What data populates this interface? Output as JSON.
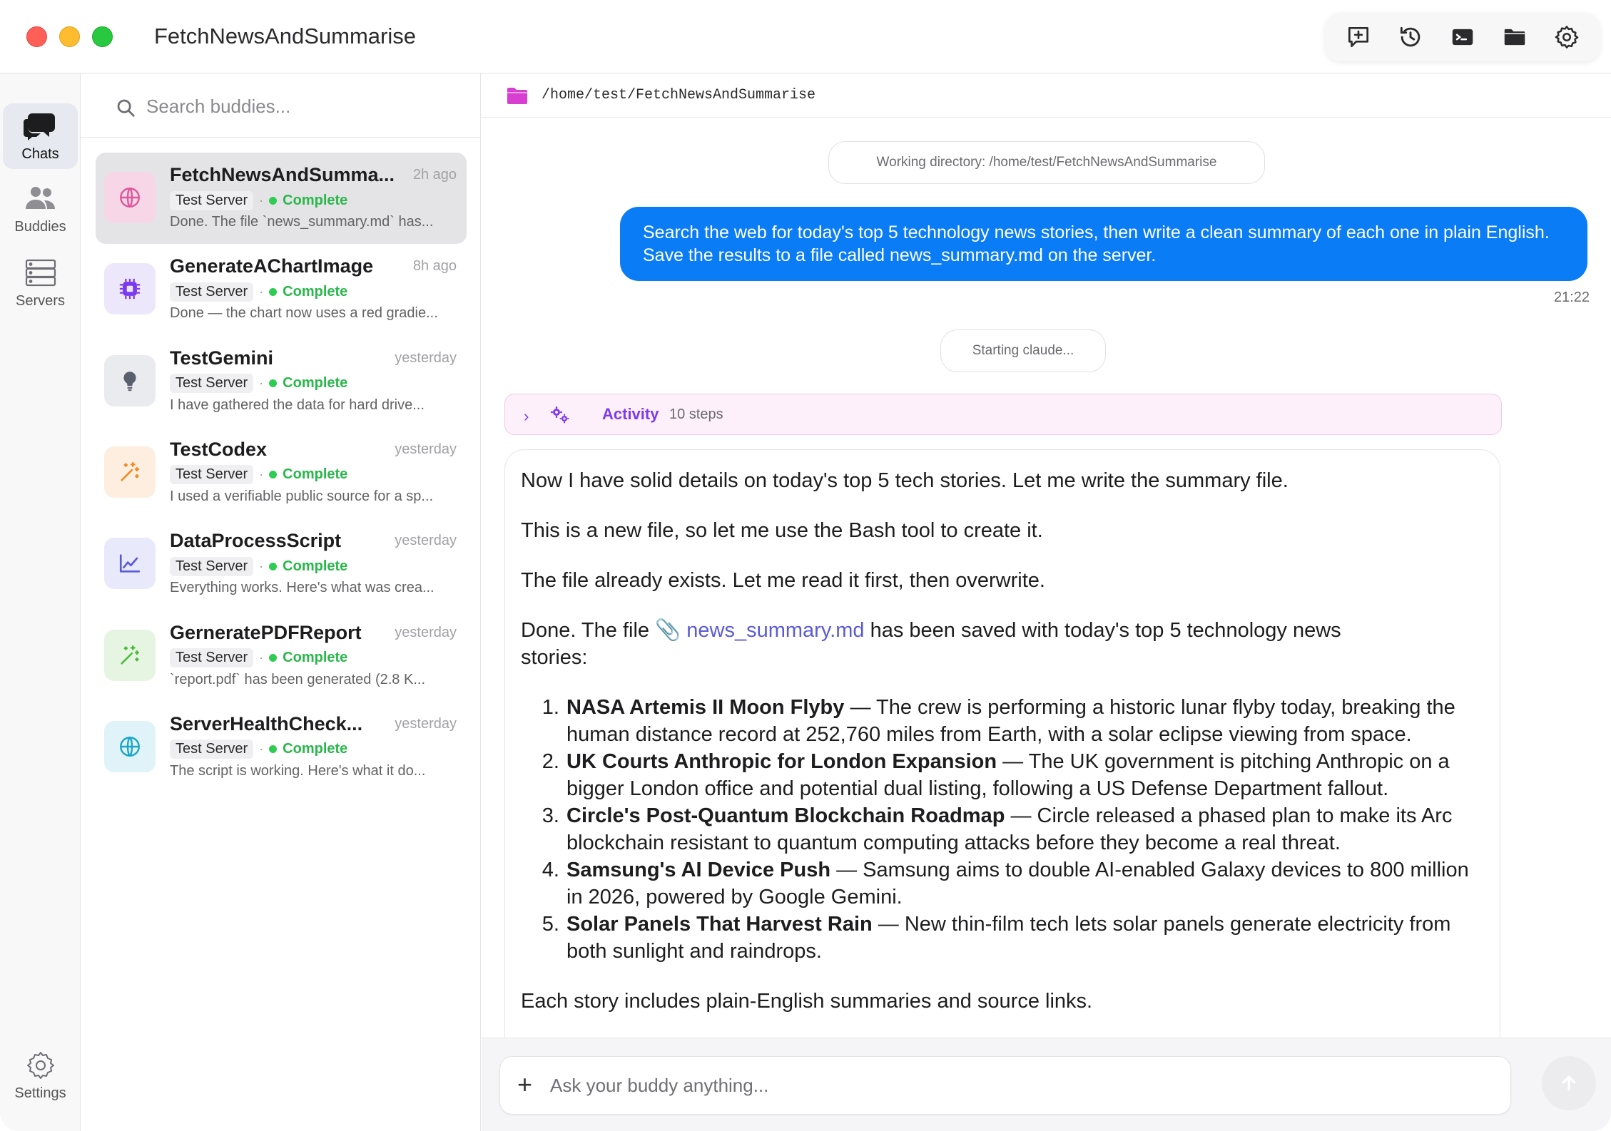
{
  "window": {
    "title": "FetchNewsAndSummarise"
  },
  "rail": {
    "items": [
      {
        "label": "Chats",
        "icon": "chat-bubbles-icon"
      },
      {
        "label": "Buddies",
        "icon": "people-icon"
      },
      {
        "label": "Servers",
        "icon": "server-icon"
      }
    ],
    "settings_label": "Settings"
  },
  "search": {
    "placeholder": "Search buddies..."
  },
  "chats": [
    {
      "name": "FetchNewsAndSumma...",
      "time": "2h ago",
      "server": "Test Server",
      "status": "Complete",
      "preview": "Done. The file `news_summary.md` has...",
      "icon": "globe-icon",
      "icon_color": "#e0569a",
      "icon_bg": "#f7d6e7"
    },
    {
      "name": "GenerateAChartImage",
      "time": "8h ago",
      "server": "Test Server",
      "status": "Complete",
      "preview": "Done — the chart now uses a red gradie...",
      "icon": "chip-icon",
      "icon_color": "#7c3aed",
      "icon_bg": "#ede7fb"
    },
    {
      "name": "TestGemini",
      "time": "yesterday",
      "server": "Test Server",
      "status": "Complete",
      "preview": "I have gathered the data for hard drive...",
      "icon": "lightbulb-icon",
      "icon_color": "#5a5f6e",
      "icon_bg": "#eaebee"
    },
    {
      "name": "TestCodex",
      "time": "yesterday",
      "server": "Test Server",
      "status": "Complete",
      "preview": "I used a verifiable public source for a sp...",
      "icon": "sparkle-wand-icon",
      "icon_color": "#f08a24",
      "icon_bg": "#fdeee0"
    },
    {
      "name": "DataProcessScript",
      "time": "yesterday",
      "server": "Test Server",
      "status": "Complete",
      "preview": "Everything works. Here's what was crea...",
      "icon": "line-chart-icon",
      "icon_color": "#5b5bd6",
      "icon_bg": "#e8e9fb"
    },
    {
      "name": "GerneratePDFReport",
      "time": "yesterday",
      "server": "Test Server",
      "status": "Complete",
      "preview": "`report.pdf` has been generated (2.8 K...",
      "icon": "sparkle-wand-icon",
      "icon_color": "#4cbb3a",
      "icon_bg": "#e6f5e2"
    },
    {
      "name": "ServerHealthCheck...",
      "time": "yesterday",
      "server": "Test Server",
      "status": "Complete",
      "preview": "The script is working. Here's what it do...",
      "icon": "globe-icon",
      "icon_color": "#1aa6c9",
      "icon_bg": "#dff3f8"
    }
  ],
  "main": {
    "path": "/home/test/FetchNewsAndSummarise",
    "working_dir_label": "Working directory: /home/test/FetchNewsAndSummarise",
    "user_message": "Search the web for today's top 5 technology news stories, then write a clean summary of each one in plain English. Save the results to a file called news_summary.md on the server.",
    "user_message_time": "21:22",
    "status_pill": "Starting claude...",
    "activity": {
      "label": "Activity",
      "steps": "10 steps"
    },
    "response": {
      "p1": "Now I have solid details on today's top 5 tech stories. Let me write the summary file.",
      "p2": "This is a new file, so let me use the Bash tool to create it.",
      "p3": "The file already exists. Let me read it first, then overwrite.",
      "p4_before": "Done. The file",
      "p4_link": "news_summary.md",
      "p4_after": "has been saved with today's top 5 technology news stories:",
      "stories": [
        {
          "title": "NASA Artemis II Moon Flyby",
          "text": " — The crew is performing a historic lunar flyby today, breaking the human distance record at 252,760 miles from Earth, with a solar eclipse viewing from space."
        },
        {
          "title": "UK Courts Anthropic for London Expansion",
          "text": " — The UK government is pitching Anthropic on a bigger London office and potential dual listing, following a US Defense Department fallout."
        },
        {
          "title": "Circle's Post-Quantum Blockchain Roadmap",
          "text": " — Circle released a phased plan to make its Arc blockchain resistant to quantum computing attacks before they become a real threat."
        },
        {
          "title": "Samsung's AI Device Push",
          "text": " — Samsung aims to double AI-enabled Galaxy devices to 800 million in 2026, powered by Google Gemini."
        },
        {
          "title": "Solar Panels That Harvest Rain",
          "text": " — New thin-film tech lets solar panels generate electricity from both sunlight and raindrops."
        }
      ],
      "p5": "Each story includes plain-English summaries and source links."
    },
    "composer": {
      "placeholder": "Ask your buddy anything..."
    }
  },
  "colors": {
    "accent_blue": "#0a7cf5",
    "status_green": "#28b84a",
    "activity_purple": "#7c3aed",
    "folder_magenta": "#d63fd0"
  }
}
